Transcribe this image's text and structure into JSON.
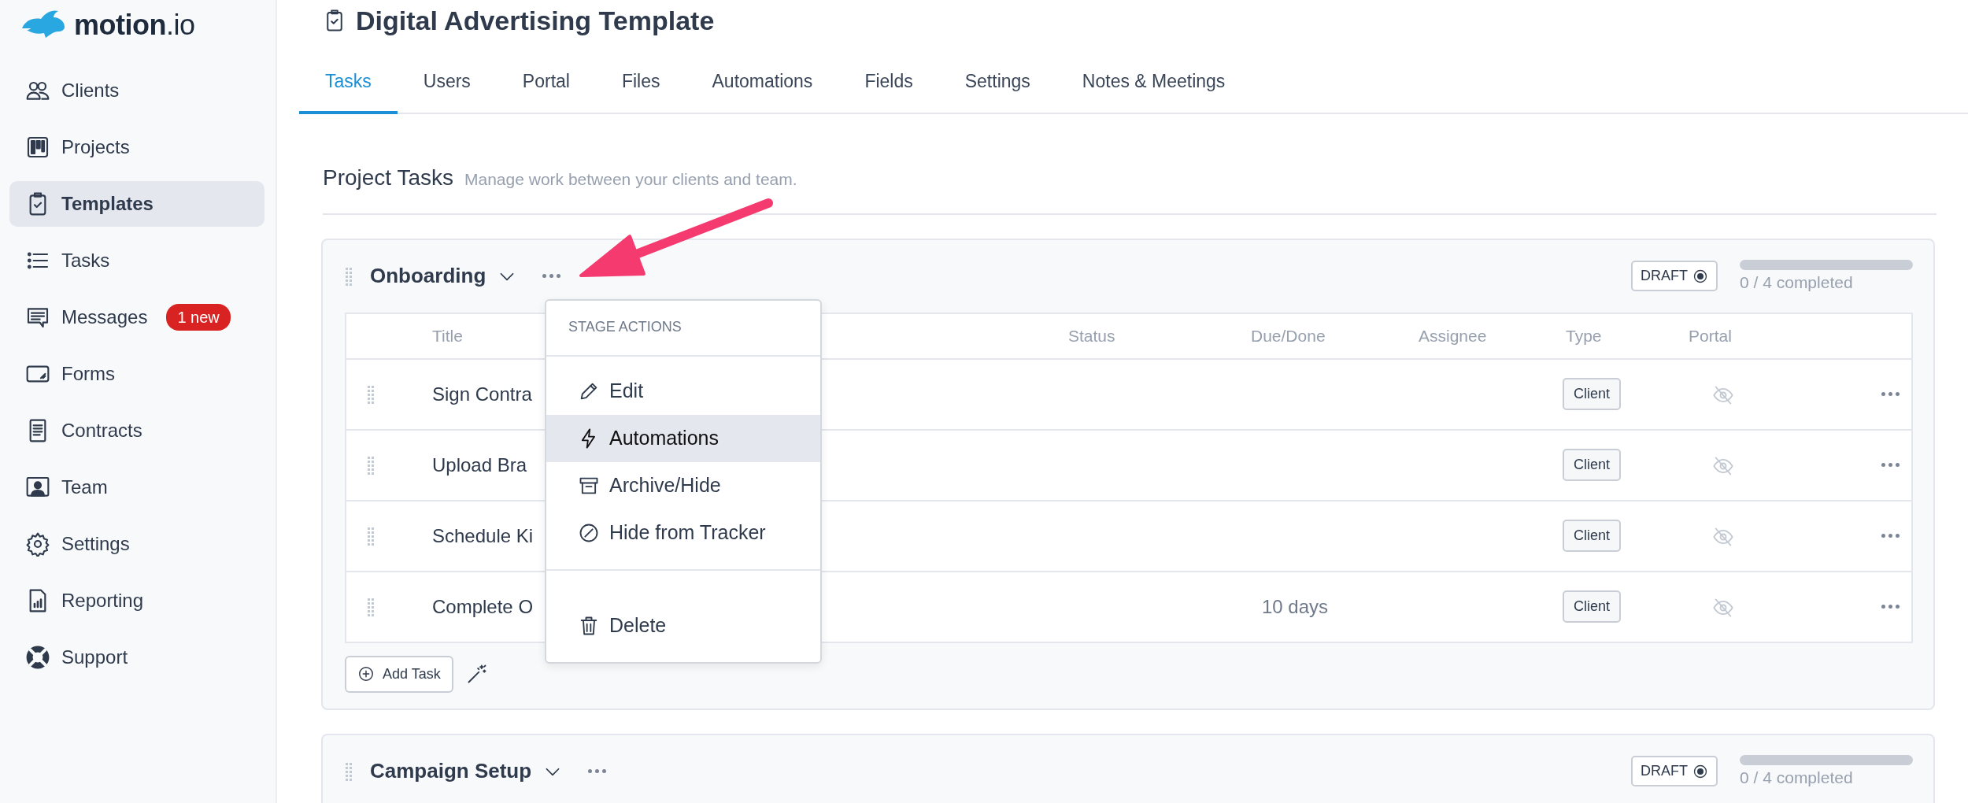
{
  "sidebar": {
    "logo": "**motion**.io",
    "items": [
      {
        "label": "Clients",
        "kind": "clients",
        "selected": false
      },
      {
        "label": "Projects",
        "kind": "projects",
        "selected": false
      },
      {
        "label": "Templates",
        "kind": "templates",
        "selected": true
      },
      {
        "label": "Tasks",
        "kind": "tasks",
        "selected": false
      },
      {
        "label": "Messages",
        "kind": "messages",
        "selected": false,
        "badge": "1 new"
      },
      {
        "label": "Forms",
        "kind": "forms",
        "selected": false
      },
      {
        "label": "Contracts",
        "kind": "contracts",
        "selected": false
      },
      {
        "label": "Team",
        "kind": "team",
        "selected": false
      },
      {
        "label": "Settings",
        "kind": "settings",
        "selected": false
      },
      {
        "label": "Reporting",
        "kind": "reporting",
        "selected": false
      },
      {
        "label": "Support",
        "kind": "support",
        "selected": false
      }
    ]
  },
  "page": {
    "title": "Digital Advertising Template"
  },
  "tabs": [
    {
      "label": "Tasks",
      "selected": true
    },
    {
      "label": "Users",
      "selected": false
    },
    {
      "label": "Portal",
      "selected": false
    },
    {
      "label": "Files",
      "selected": false
    },
    {
      "label": "Automations",
      "selected": false
    },
    {
      "label": "Fields",
      "selected": false
    },
    {
      "label": "Settings",
      "selected": false
    },
    {
      "label": "Notes & Meetings",
      "selected": false
    }
  ],
  "section": {
    "title": "Project Tasks",
    "subtitle": "Manage work between your clients and team."
  },
  "stages": [
    {
      "name": "Onboarding",
      "expanded": true,
      "status": "DRAFT",
      "level": 0,
      "progress_text": "0 / 4 completed",
      "columns": [
        "Title",
        "Status",
        "Due/Done",
        "Assignee",
        "Type",
        "Portal"
      ],
      "tasks": [
        {
          "title": "Sign Contra",
          "type": "Client",
          "portal": false
        },
        {
          "title": "Upload Bra",
          "type": "Client",
          "portal": false
        },
        {
          "title": "Schedule Ki",
          "type": "Client",
          "portal": false
        },
        {
          "title": "Complete O",
          "due": "10 days",
          "type": "Client",
          "portal": false
        }
      ],
      "add_task": "Add Task"
    },
    {
      "name": "Campaign Setup",
      "expanded": true,
      "status": "DRAFT",
      "level": 0,
      "progress_text": "0 / 4 completed"
    }
  ],
  "menu": {
    "heading": "STAGE ACTIONS",
    "sections": [
      [
        {
          "label": "Edit",
          "kind": "edit",
          "selected": false
        },
        {
          "label": "Automations",
          "kind": "automation",
          "selected": true
        },
        {
          "label": "Archive/Hide",
          "kind": "archive",
          "selected": false
        },
        {
          "label": "Hide from Tracker",
          "kind": "hide",
          "selected": false
        }
      ],
      [
        {
          "label": "Delete",
          "kind": "delete",
          "selected": false
        }
      ]
    ]
  }
}
